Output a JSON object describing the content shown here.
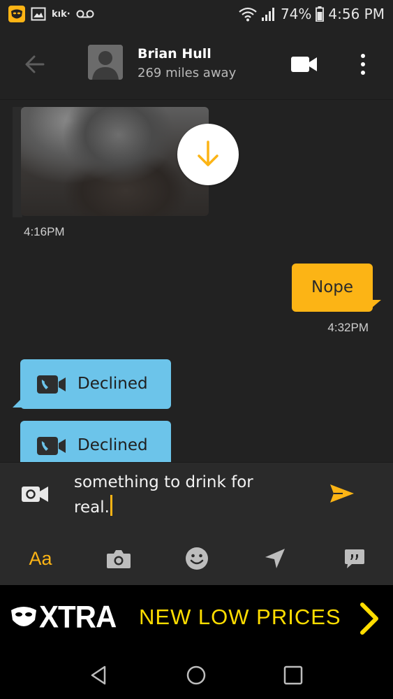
{
  "status_bar": {
    "app_icons": [
      "grindr-icon",
      "image-icon",
      "kik-icon",
      "voicemail-icon"
    ],
    "kik_label": "kık·",
    "battery": "74%",
    "time": "4:56 PM"
  },
  "header": {
    "name": "Brian Hull",
    "distance": "269 miles away"
  },
  "messages": {
    "image_timestamp": "4:16PM",
    "outgoing": {
      "text": "Nope",
      "timestamp": "4:32PM"
    },
    "calls": [
      {
        "label": "Declined"
      },
      {
        "label": "Declined"
      }
    ]
  },
  "composer": {
    "text": "something to drink for\nreal."
  },
  "toolbar": {
    "text_label": "Aa"
  },
  "ad": {
    "brand": "XTRA",
    "tagline": "NEW LOW PRICES"
  },
  "colors": {
    "accent": "#fcb415",
    "call_bubble": "#6cc4ea",
    "background": "#222222",
    "ad_text": "#ffdd00"
  }
}
